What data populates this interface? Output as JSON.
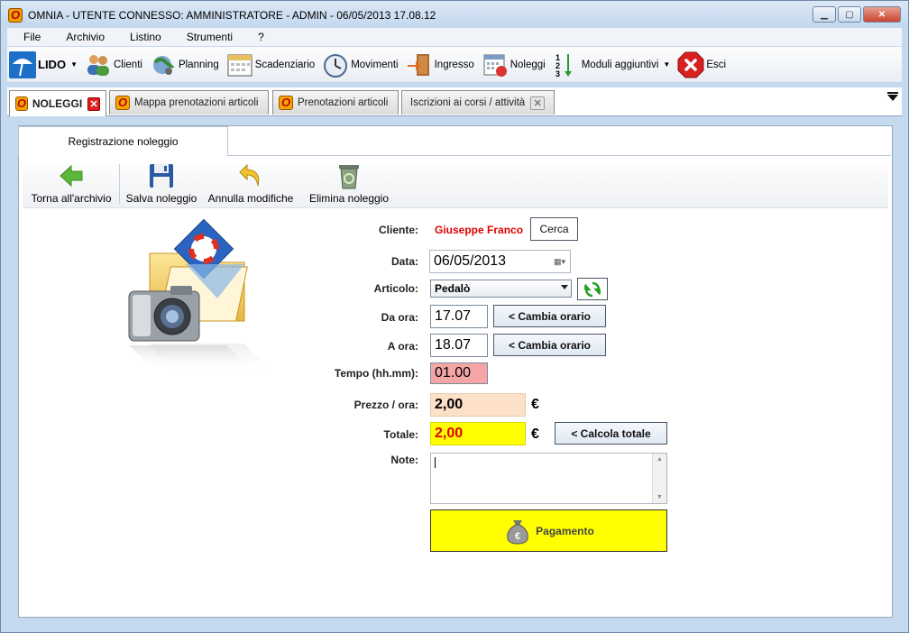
{
  "window": {
    "title": "OMNIA - UTENTE CONNESSO: AMMINISTRATORE - ADMIN - 06/05/2013 17.08.12"
  },
  "menu": [
    "File",
    "Archivio",
    "Listino",
    "Strumenti",
    "?"
  ],
  "toolbar": {
    "lido": "LIDO",
    "clienti": "Clienti",
    "planning": "Planning",
    "scadenziario": "Scadenziario",
    "movimenti": "Movimenti",
    "ingresso": "Ingresso",
    "noleggi": "Noleggi",
    "moduli": "Moduli aggiuntivi",
    "esci": "Esci"
  },
  "tabs": [
    {
      "label": "NOLEGGI"
    },
    {
      "label": "Mappa prenotazioni articoli"
    },
    {
      "label": "Prenotazioni articoli"
    },
    {
      "label": "Iscrizioni ai corsi / attività"
    }
  ],
  "subtab": "Registrazione noleggio",
  "actions": {
    "back": "Torna all'archivio",
    "save": "Salva noleggio",
    "undo": "Annulla modifiche",
    "delete": "Elimina noleggio"
  },
  "form": {
    "cliente_label": "Cliente:",
    "cliente_value": "Giuseppe Franco",
    "cerca": "Cerca",
    "data_label": "Data:",
    "data_value": "06/05/2013",
    "articolo_label": "Articolo:",
    "articolo_value": "Pedalò",
    "da_ora_label": "Da ora:",
    "da_ora_value": "17.07",
    "a_ora_label": "A ora:",
    "a_ora_value": "18.07",
    "cambia_orario": "< Cambia orario",
    "tempo_label": "Tempo (hh.mm):",
    "tempo_value": "01.00",
    "prezzo_label": "Prezzo / ora:",
    "prezzo_value": "2,00",
    "totale_label": "Totale:",
    "totale_value": "2,00",
    "euro": "€",
    "calcola": "< Calcola totale",
    "note_label": "Note:",
    "note_value": "",
    "pagamento": "Pagamento"
  },
  "colors": {
    "tempo_bg": "#f4a6a6",
    "prezzo_bg": "#fde0c8",
    "totale_bg": "#ffff00",
    "cliente_text": "#e00000",
    "totale_text": "#e00000"
  }
}
